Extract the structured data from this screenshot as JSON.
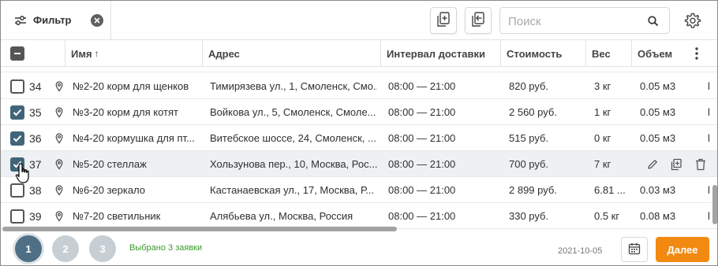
{
  "toolbar": {
    "filter_label": "Фильтр",
    "search_placeholder": "Поиск"
  },
  "columns": {
    "name": "Имя",
    "name_sort_glyph": "↑",
    "address": "Адрес",
    "interval": "Интервал доставки",
    "cost": "Стоимость",
    "weight": "Вес",
    "volume": "Объем"
  },
  "rows": [
    {
      "num": "34",
      "checked": false,
      "name": "№2-20 корм для щенков",
      "address": "Тимирязева ул., 1, Смоленск, Смо...",
      "interval": "08:00 — 21:00",
      "cost": "820 руб.",
      "weight": "3 кг",
      "volume": "0.05 м3",
      "extra": "l"
    },
    {
      "num": "35",
      "checked": true,
      "name": "№3-20 корм для котят",
      "address": "Войкова ул., 5, Смоленск, Смоле...",
      "interval": "08:00 — 21:00",
      "cost": "2 560 руб.",
      "weight": "1 кг",
      "volume": "0.05 м3",
      "extra": "l"
    },
    {
      "num": "36",
      "checked": true,
      "name": "№4-20 кормушка для пт...",
      "address": "Витебское шоссе, 24, Смоленск, ...",
      "interval": "08:00 — 21:00",
      "cost": "515 руб.",
      "weight": "0 кг",
      "volume": "0.05 м3",
      "extra": "l"
    },
    {
      "num": "37",
      "checked": true,
      "name": "№5-20 стеллаж",
      "address": "Хользунова пер., 10, Москва, Рос...",
      "interval": "08:00 — 21:00",
      "cost": "700 руб.",
      "weight": "7 кг",
      "volume": "",
      "extra": ""
    },
    {
      "num": "38",
      "checked": false,
      "name": "№6-20 зеркало",
      "address": "Кастанаевская ул., 17, Москва, Р...",
      "interval": "08:00 — 21:00",
      "cost": "2 899 руб.",
      "weight": "6.81 ...",
      "volume": "0.03 м3",
      "extra": "l"
    },
    {
      "num": "39",
      "checked": false,
      "name": "№7-20 светильник",
      "address": "Алябьева ул., Москва, Россия",
      "interval": "08:00 — 21:00",
      "cost": "330 руб.",
      "weight": "0.5 кг",
      "volume": "0.08 м3",
      "extra": "l"
    }
  ],
  "pagination": {
    "pages": [
      "1",
      "2",
      "3"
    ],
    "active_page": "1"
  },
  "footer": {
    "selected_text": "Выбрано 3 заявки",
    "date": "2021-10-05",
    "next_label": "Далее"
  },
  "colors": {
    "accent_orange": "#f28a12",
    "checkbox_checked": "#40657a",
    "selected_text": "#3a9a2a",
    "page_active": "#4f6f84",
    "page_inactive": "#c8cfd4"
  },
  "icons": {
    "filter": "sliders-icon",
    "clear_filter": "close-circle-icon",
    "add_doc": "add-document-icon",
    "import_doc": "import-document-icon",
    "search": "search-icon",
    "settings": "gear-icon",
    "column_menu": "kebab-menu-icon",
    "row_location": "map-pin-icon",
    "row_edit": "pencil-icon",
    "row_duplicate": "duplicate-icon",
    "row_delete": "trash-icon",
    "calendar": "calendar-icon"
  }
}
